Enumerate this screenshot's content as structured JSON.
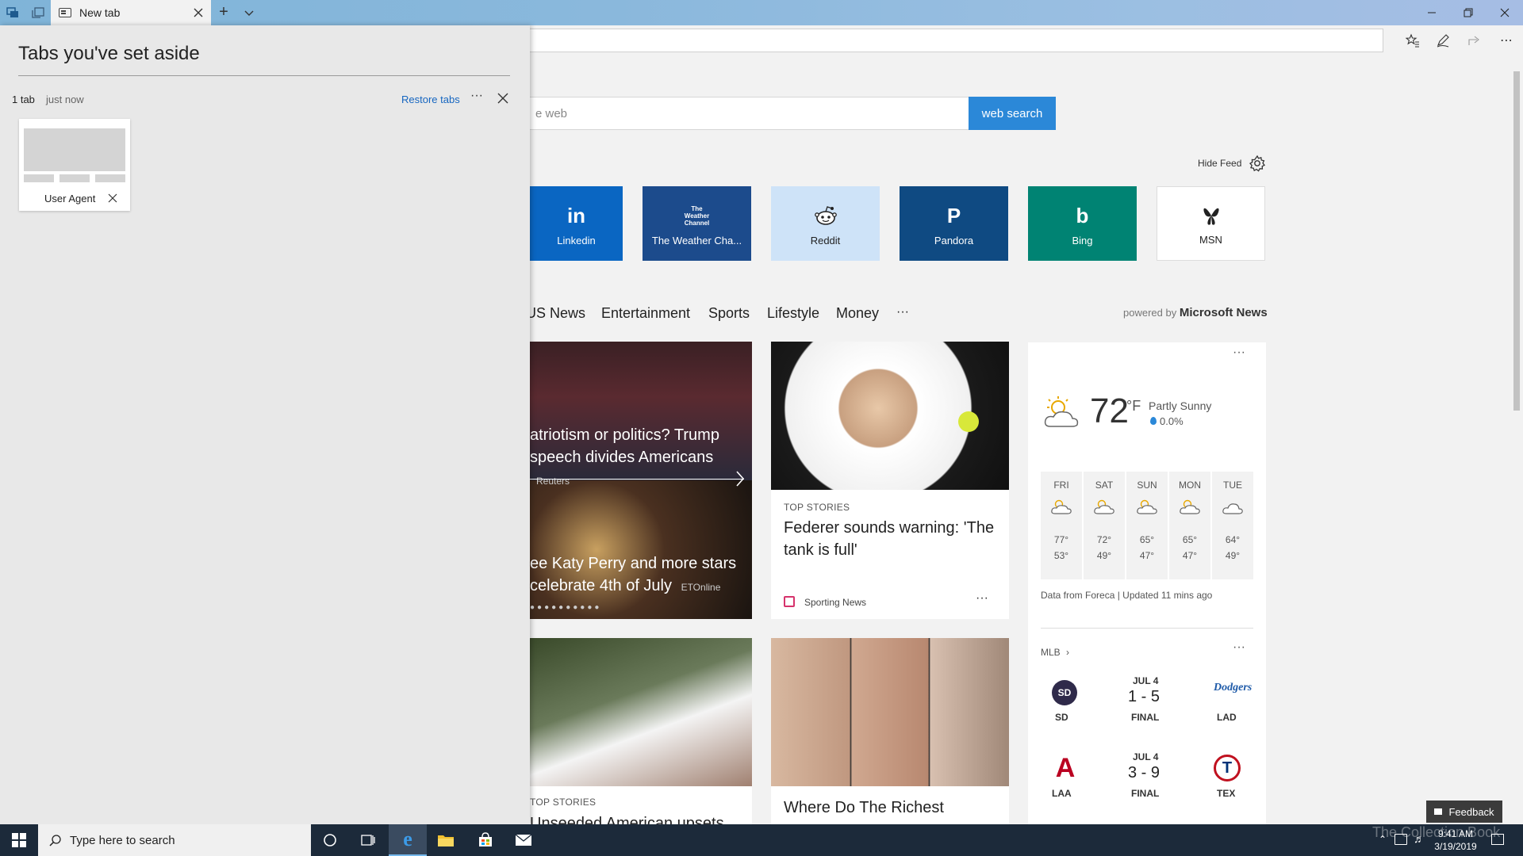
{
  "browser": {
    "tab_title": "New tab"
  },
  "page": {
    "search_placeholder": "e web",
    "search_button": "web search",
    "hide_feed": "Hide Feed",
    "tiles": [
      {
        "label": "Linkedin",
        "glyph": "in",
        "color": "#0a66c2"
      },
      {
        "label": "The Weather Cha...",
        "glyph": "The Weather Channel",
        "color": "#1c4b8c"
      },
      {
        "label": "Reddit",
        "glyph": "reddit-icon",
        "color": "#cee3f8"
      },
      {
        "label": "Pandora",
        "glyph": "P",
        "color": "#0f4a82"
      },
      {
        "label": "Bing",
        "glyph": "b",
        "color": "#008373"
      },
      {
        "label": "MSN",
        "glyph": "msn-butterfly-icon",
        "color": "#ffffff"
      }
    ],
    "categories": [
      "US News",
      "Entertainment",
      "Sports",
      "Lifestyle",
      "Money",
      "···"
    ],
    "powered_by_prefix": "powered by",
    "powered_by_brand": "Microsoft News",
    "hero": {
      "story1": "atriotism or politics? Trump speech divides Americans",
      "story1_source": "Reuters",
      "story2": "ee Katy Perry and more stars celebrate 4th of July",
      "story2_source": "ETOnline"
    },
    "card_federer": {
      "kicker": "TOP STORIES",
      "headline": "Federer sounds warning: 'The tank is full'",
      "source": "Sporting News",
      "more": "···"
    },
    "card_tennis": {
      "kicker": "TOP STORIES",
      "headline": "Unseeded American upsets"
    },
    "card_richest": {
      "headline": "Where Do The Richest"
    },
    "weather": {
      "temp": "72",
      "unit": "°F",
      "condition": "Partly Sunny",
      "precip": "0.0%",
      "days": [
        {
          "day": "FRI",
          "hi": "77°",
          "lo": "53°",
          "icon": "partly-sunny-icon"
        },
        {
          "day": "SAT",
          "hi": "72°",
          "lo": "49°",
          "icon": "partly-sunny-icon"
        },
        {
          "day": "SUN",
          "hi": "65°",
          "lo": "47°",
          "icon": "partly-sunny-icon"
        },
        {
          "day": "MON",
          "hi": "65°",
          "lo": "47°",
          "icon": "partly-sunny-icon"
        },
        {
          "day": "TUE",
          "hi": "64°",
          "lo": "49°",
          "icon": "cloudy-icon"
        }
      ],
      "footer": "Data from Foreca | Updated 11 mins ago",
      "more": "···"
    },
    "mlb": {
      "title": "MLB",
      "more": "···",
      "games": [
        {
          "home": "SD",
          "away": "LAD",
          "date": "JUL 4",
          "score": "1 - 5",
          "status": "FINAL"
        },
        {
          "home": "LAA",
          "away": "TEX",
          "date": "JUL 4",
          "score": "3 - 9",
          "status": "FINAL"
        }
      ]
    },
    "feedback": "Feedback"
  },
  "panel": {
    "title": "Tabs you've set aside",
    "count": "1 tab",
    "time": "just now",
    "restore": "Restore tabs",
    "more": "···",
    "tab_label": "User Agent"
  },
  "taskbar": {
    "search_placeholder": "Type here to search",
    "time": "9:41 AM",
    "date": "3/19/2019"
  },
  "watermark": "The Collection Book",
  "colors": {
    "accent": "#2b88d8",
    "link": "#1666c0",
    "taskbar": "#1c2a3a"
  }
}
